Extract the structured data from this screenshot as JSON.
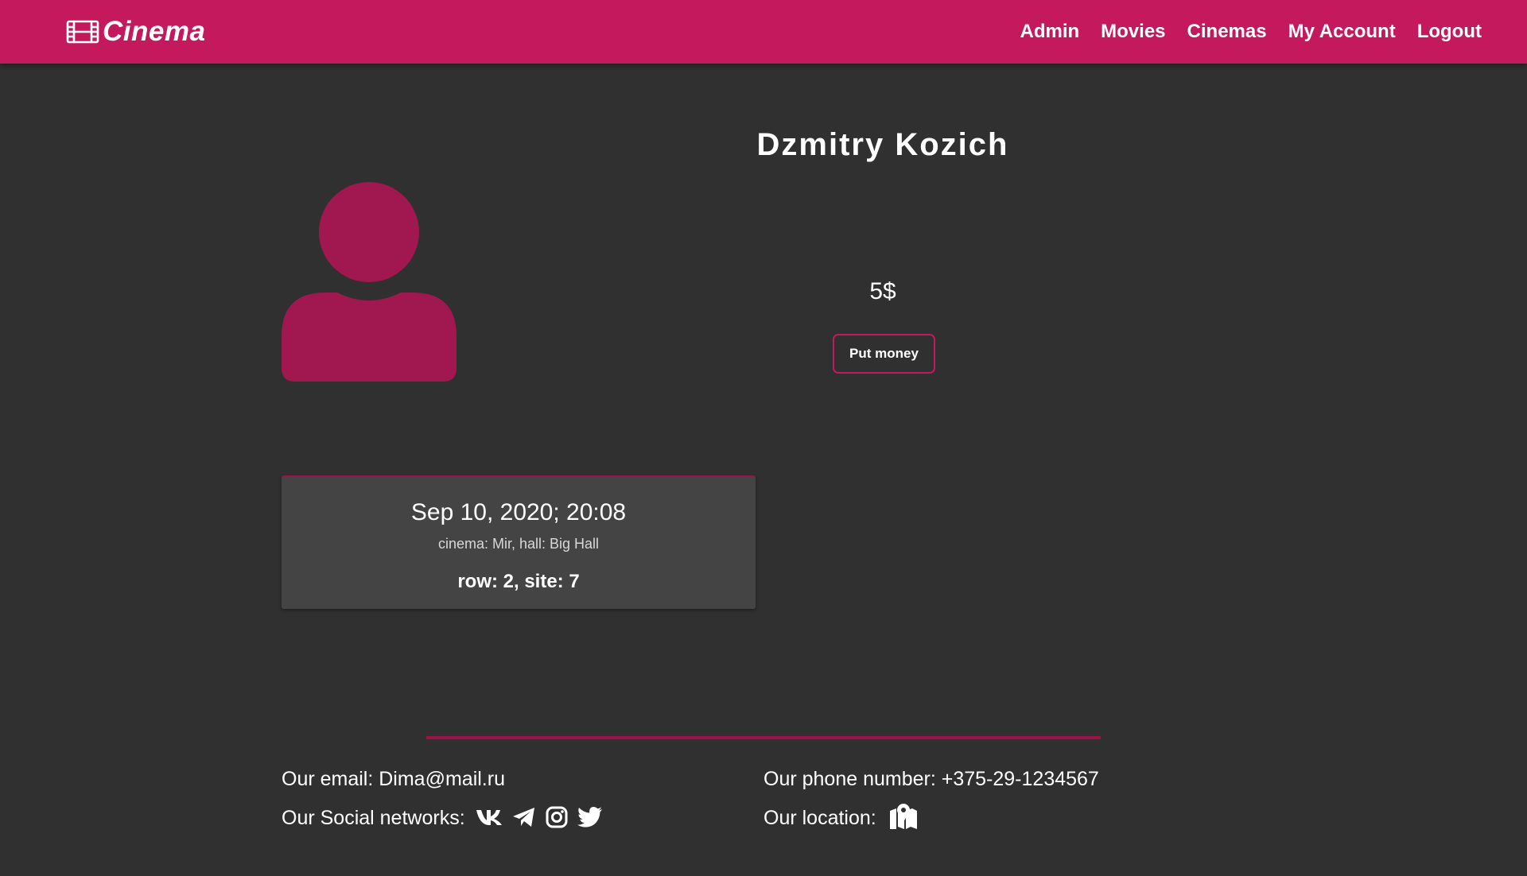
{
  "app": {
    "logo_text": "Cinema",
    "brand_color": "#c4195c",
    "accent_dark": "#9c1248",
    "background": "#303030"
  },
  "nav": {
    "items": [
      {
        "label": "Admin"
      },
      {
        "label": "Movies"
      },
      {
        "label": "Cinemas"
      },
      {
        "label": "My Account"
      },
      {
        "label": "Logout"
      }
    ]
  },
  "profile": {
    "name": "Dzmitry Kozich",
    "balance": "5$",
    "put_money_label": "Put money",
    "avatar_icon": "user-icon"
  },
  "tickets": [
    {
      "date": "Sep 10, 2020; 20:08",
      "place": "cinema: Mir, hall: Big Hall",
      "seat": "row: 2, site: 7"
    }
  ],
  "footer": {
    "email": "Our email: Dima@mail.ru",
    "phone": "Our phone number: +375-29-1234567",
    "social_label": "Our Social networks:",
    "location_label": "Our location:",
    "social_icons": [
      "vk-icon",
      "telegram-icon",
      "instagram-icon",
      "twitter-icon"
    ],
    "location_icon": "map-marker-icon"
  }
}
